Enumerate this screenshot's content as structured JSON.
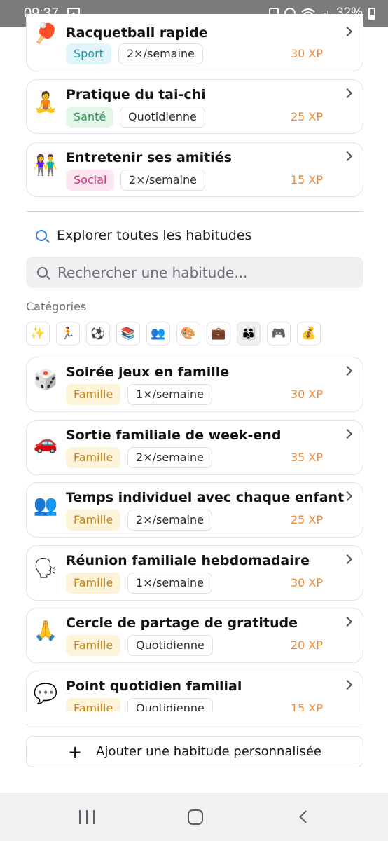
{
  "status_bar": {
    "time": "09:37",
    "battery": "32%"
  },
  "top_habits": [
    {
      "emoji": "🏓",
      "title": "Racquetball rapide",
      "category": "Sport",
      "category_style": "sport",
      "frequency": "2×/semaine",
      "xp": "30 XP"
    },
    {
      "emoji": "🧘",
      "title": "Pratique du tai-chi",
      "category": "Santé",
      "category_style": "sante",
      "frequency": "Quotidienne",
      "xp": "25 XP"
    },
    {
      "emoji": "👫",
      "title": "Entretenir ses amitiés",
      "category": "Social",
      "category_style": "social",
      "frequency": "2×/semaine",
      "xp": "15 XP"
    }
  ],
  "explore": {
    "title": "Explorer toutes les habitudes",
    "search_placeholder": "Rechercher une habitude...",
    "categories_label": "Catégories",
    "category_icons": [
      "✨",
      "🏃",
      "⚽",
      "📚",
      "👥",
      "🎨",
      "💼",
      "👪",
      "🎮",
      "💰"
    ],
    "active_category_index": 7
  },
  "family_habits": [
    {
      "emoji": "🎲",
      "title": "Soirée jeux en famille",
      "category": "Famille",
      "frequency": "1×/semaine",
      "xp": "30 XP"
    },
    {
      "emoji": "🚗",
      "title": "Sortie familiale de week-end",
      "category": "Famille",
      "frequency": "2×/semaine",
      "xp": "35 XP"
    },
    {
      "emoji": "👥",
      "title": "Temps individuel avec chaque enfant",
      "category": "Famille",
      "frequency": "2×/semaine",
      "xp": "25 XP"
    },
    {
      "emoji": "🗣",
      "title": "Réunion familiale hebdomadaire",
      "category": "Famille",
      "frequency": "1×/semaine",
      "xp": "30 XP"
    },
    {
      "emoji": "🙏",
      "title": "Cercle de partage de gratitude",
      "category": "Famille",
      "frequency": "Quotidienne",
      "xp": "20 XP"
    },
    {
      "emoji": "💬",
      "title": "Point quotidien familial",
      "category": "Famille",
      "frequency": "Quotidienne",
      "xp": "15 XP"
    }
  ],
  "add_button": {
    "plus": "+",
    "label": "Ajouter une habitude personnalisée"
  },
  "colors": {
    "xp": "#ef8a33",
    "accent": "#2f7ad8",
    "famille_bg": "#fdf3d8",
    "famille_text": "#c7841d"
  }
}
